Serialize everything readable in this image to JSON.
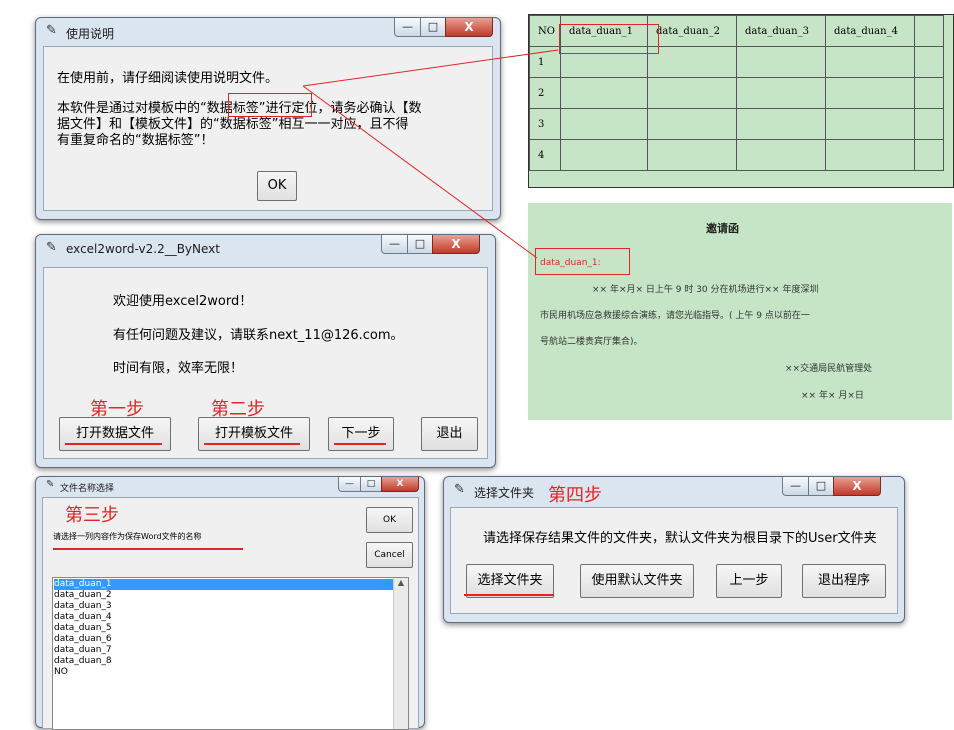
{
  "win_usage": {
    "title": "使用说明",
    "line1": "在使用前，请仔细阅读使用说明文件。",
    "line2": "本软件是通过对模板中的“数据标签”进行定位，请务必确认【数",
    "line3": "据文件】和【模板文件】的“数据标签”相互一一对应，且不得",
    "line4": "有重复命名的“数据标签”！",
    "ok_label": "OK"
  },
  "table_panel": {
    "headers": [
      "NO",
      "data_duan_1",
      "data_duan_2",
      "data_duan_3",
      "data_duan_4"
    ],
    "rows": [
      "1",
      "2",
      "3",
      "4"
    ]
  },
  "win_main": {
    "title": "excel2word-v2.2__ByNext",
    "welcome": "欢迎使用excel2word！",
    "contact": "有任何问题及建议，请联系next_11@126.com。",
    "motto": "时间有限，效率无限！",
    "step1": "第一步",
    "step2": "第二步",
    "btn_open_data": "打开数据文件",
    "btn_open_template": "打开模板文件",
    "btn_next": "下一步",
    "btn_exit": "退出"
  },
  "doc_panel": {
    "title": "邀请函",
    "tag": "data_duan_1:",
    "line1": "××  年×月×  日上午 9  时 30  分在机场进行××  年度深圳",
    "line2": "市民用机场应急救援综合演练，请您光临指导。( 上午 9  点以前在一",
    "line3": "号航站二楼贵宾厅集合)。",
    "sign1": "××交通局民航管理处",
    "sign2": "××  年×  月×日"
  },
  "win_select_name": {
    "title": "文件名称选择",
    "step3": "第三步",
    "prompt": "请选择一列内容作为保存Word文件的名称",
    "ok_label": "OK",
    "cancel_label": "Cancel",
    "items": [
      "data_duan_1",
      "data_duan_2",
      "data_duan_3",
      "data_duan_4",
      "data_duan_5",
      "data_duan_6",
      "data_duan_7",
      "data_duan_8",
      "NO"
    ]
  },
  "win_folder": {
    "title": "选择文件夹",
    "step4": "第四步",
    "prompt": "请选择保存结果文件的文件夹，默认文件夹为根目录下的User文件夹",
    "btn_select": "选择文件夹",
    "btn_default": "使用默认文件夹",
    "btn_prev": "上一步",
    "btn_quit": "退出程序"
  },
  "window_controls": {
    "min": "—",
    "max": "□",
    "close": "X"
  },
  "icons": {
    "feather": "feather-icon",
    "scroll_up": "scroll-up-arrow-icon"
  },
  "colors": {
    "annotation_red": "#e32424",
    "panel_green": "#c6e5c6",
    "selection_blue": "#3399ff"
  }
}
